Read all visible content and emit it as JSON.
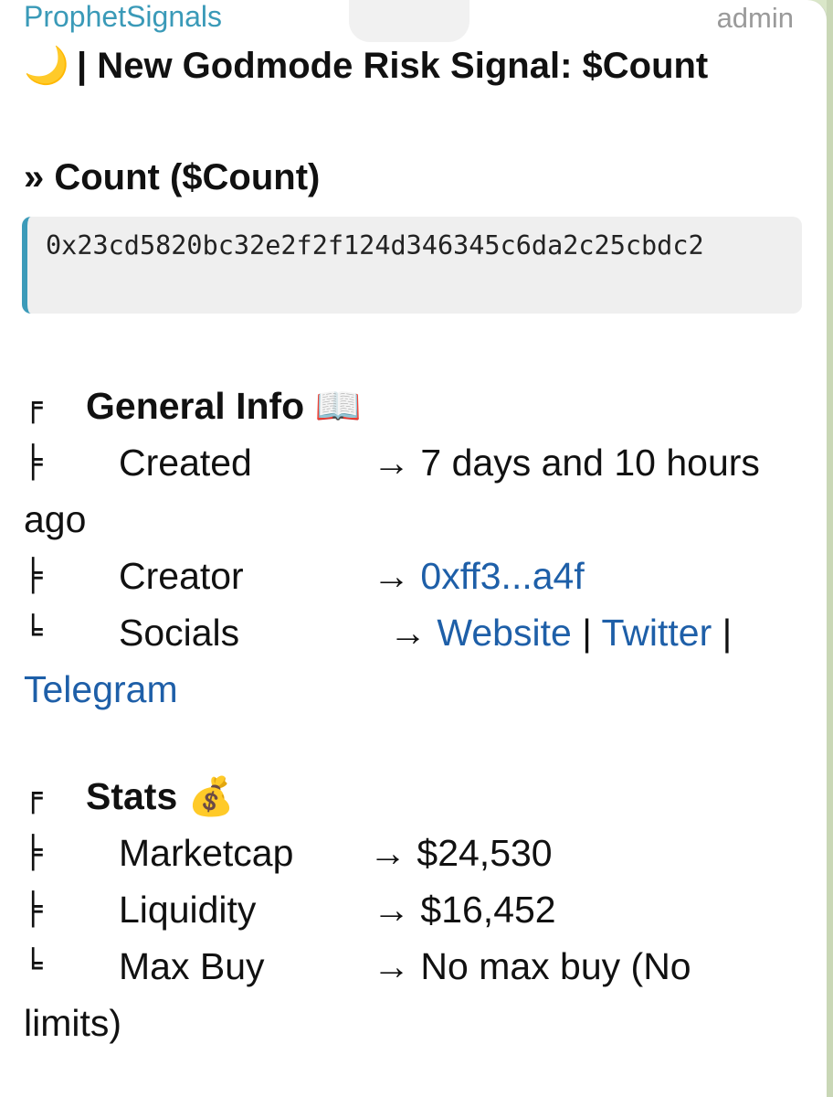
{
  "message": {
    "sender": "ProphetSignals",
    "role": "admin",
    "headline": "| New Godmode Risk Signal: $Count",
    "headline_emoji": "🌙",
    "token_heading": "» Count ($Count)",
    "contract_address": "0x23cd5820bc32e2f2f124d346345c6da2c25cbdc2"
  },
  "general": {
    "title": "General Info",
    "title_emoji": "📖",
    "created_label": "Created",
    "created_value": "→ 7 days and 10 hours",
    "created_value_cont": "ago",
    "creator_label": "Creator",
    "creator_arrow": "→",
    "creator_value": "0xff3...a4f",
    "socials_label": "Socials",
    "socials_arrow": "→",
    "social_website": "Website",
    "social_twitter": "Twitter",
    "social_telegram": "Telegram",
    "separator": "|"
  },
  "stats": {
    "title": "Stats",
    "title_emoji": "💰",
    "marketcap_label": "Marketcap",
    "marketcap_value": "→ $24,530",
    "liquidity_label": "Liquidity",
    "liquidity_value": "→ $16,452",
    "maxbuy_label": "Max Buy",
    "maxbuy_value": "→ No max buy (No",
    "maxbuy_value_cont": "limits)"
  },
  "glyphs": {
    "top": "╒",
    "mid": "╞",
    "end": "╘"
  },
  "colors": {
    "accent": "#3a9ab8",
    "link": "#1e5fa8",
    "bubble": "#ffffff",
    "background": "#d9e6c8"
  }
}
